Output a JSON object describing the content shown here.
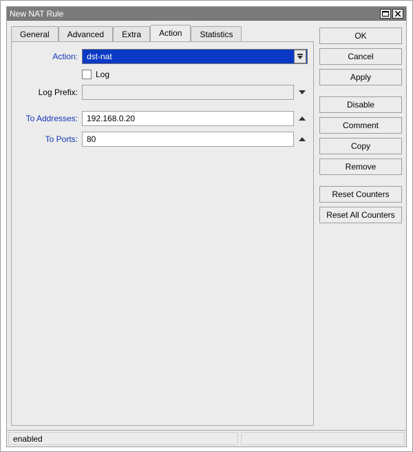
{
  "window": {
    "title": "New NAT Rule"
  },
  "tabs": [
    "General",
    "Advanced",
    "Extra",
    "Action",
    "Statistics"
  ],
  "active_tab_index": 3,
  "form": {
    "action_label": "Action:",
    "action_value": "dst-nat",
    "log_label": "Log",
    "log_checked": false,
    "log_prefix_label": "Log Prefix:",
    "log_prefix_value": "",
    "to_addresses_label": "To Addresses:",
    "to_addresses_value": "192.168.0.20",
    "to_ports_label": "To Ports:",
    "to_ports_value": "80"
  },
  "buttons": {
    "ok": "OK",
    "cancel": "Cancel",
    "apply": "Apply",
    "disable": "Disable",
    "comment": "Comment",
    "copy": "Copy",
    "remove": "Remove",
    "reset_counters": "Reset Counters",
    "reset_all_counters": "Reset All Counters"
  },
  "status": {
    "left": "enabled",
    "right": ""
  }
}
